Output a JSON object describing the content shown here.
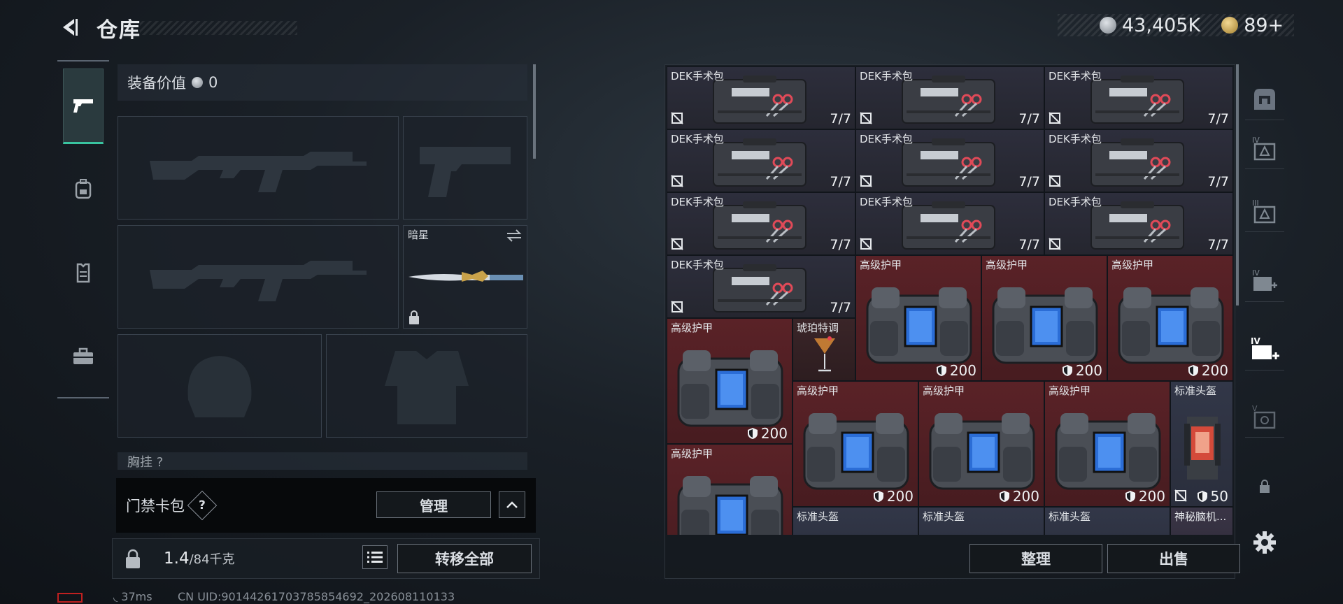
{
  "header": {
    "title": "仓库"
  },
  "currency": {
    "coins": "43,405K",
    "premium": "89+",
    "coin_color": "#9aa0a8",
    "premium_color": "#c9a24a"
  },
  "tabs": [
    {
      "icon": "pistol-icon",
      "active": true
    },
    {
      "icon": "backpack-icon",
      "active": false
    },
    {
      "icon": "vest-icon",
      "active": false
    },
    {
      "icon": "briefcase-icon",
      "active": false
    }
  ],
  "equipment": {
    "value_label": "装备价值",
    "value": "0",
    "knife_label": "暗星",
    "chest_label": "胸挂 ?"
  },
  "card_pack": {
    "label": "门禁卡包",
    "help": "?",
    "manage_label": "管理"
  },
  "weight": {
    "current": "1.4",
    "max": "/84千克"
  },
  "transfer_label": "转移全部",
  "status": {
    "ping": "37ms",
    "uid": "CN UID:90144261703785854692_202608110133"
  },
  "grid_items": [
    {
      "name": "DEK手术包",
      "type": "medkit",
      "count": "7/7"
    },
    {
      "name": "DEK手术包",
      "type": "medkit",
      "count": "7/7"
    },
    {
      "name": "DEK手术包",
      "type": "medkit",
      "count": "7/7"
    },
    {
      "name": "DEK手术包",
      "type": "medkit",
      "count": "7/7"
    },
    {
      "name": "DEK手术包",
      "type": "medkit",
      "count": "7/7"
    },
    {
      "name": "DEK手术包",
      "type": "medkit",
      "count": "7/7"
    },
    {
      "name": "DEK手术包",
      "type": "medkit",
      "count": "7/7"
    },
    {
      "name": "DEK手术包",
      "type": "medkit",
      "count": "7/7"
    },
    {
      "name": "DEK手术包",
      "type": "medkit",
      "count": "7/7"
    },
    {
      "name": "DEK手术包",
      "type": "medkit",
      "count": "7/7"
    },
    {
      "name": "高级护甲",
      "type": "armor",
      "durability": "200"
    },
    {
      "name": "高级护甲",
      "type": "armor",
      "durability": "200"
    },
    {
      "name": "高级护甲",
      "type": "armor",
      "durability": "200"
    },
    {
      "name": "高级护甲",
      "type": "armor",
      "durability": "200"
    },
    {
      "name": "琥珀特调",
      "type": "misc"
    },
    {
      "name": "高级护甲",
      "type": "armor",
      "durability": "200"
    },
    {
      "name": "高级护甲",
      "type": "armor",
      "durability": "200"
    },
    {
      "name": "高级护甲",
      "type": "armor",
      "durability": "200"
    },
    {
      "name": "标准头盔",
      "type": "helmet",
      "durability": "50"
    },
    {
      "name": "高级护甲",
      "type": "armor"
    },
    {
      "name": "标准头盔",
      "type": "helmet"
    },
    {
      "name": "标准头盔",
      "type": "helmet"
    },
    {
      "name": "标准头盔",
      "type": "helmet"
    },
    {
      "name": "神秘脑机...",
      "type": "purple"
    }
  ],
  "actions": {
    "sort_label": "整理",
    "sell_label": "出售"
  }
}
